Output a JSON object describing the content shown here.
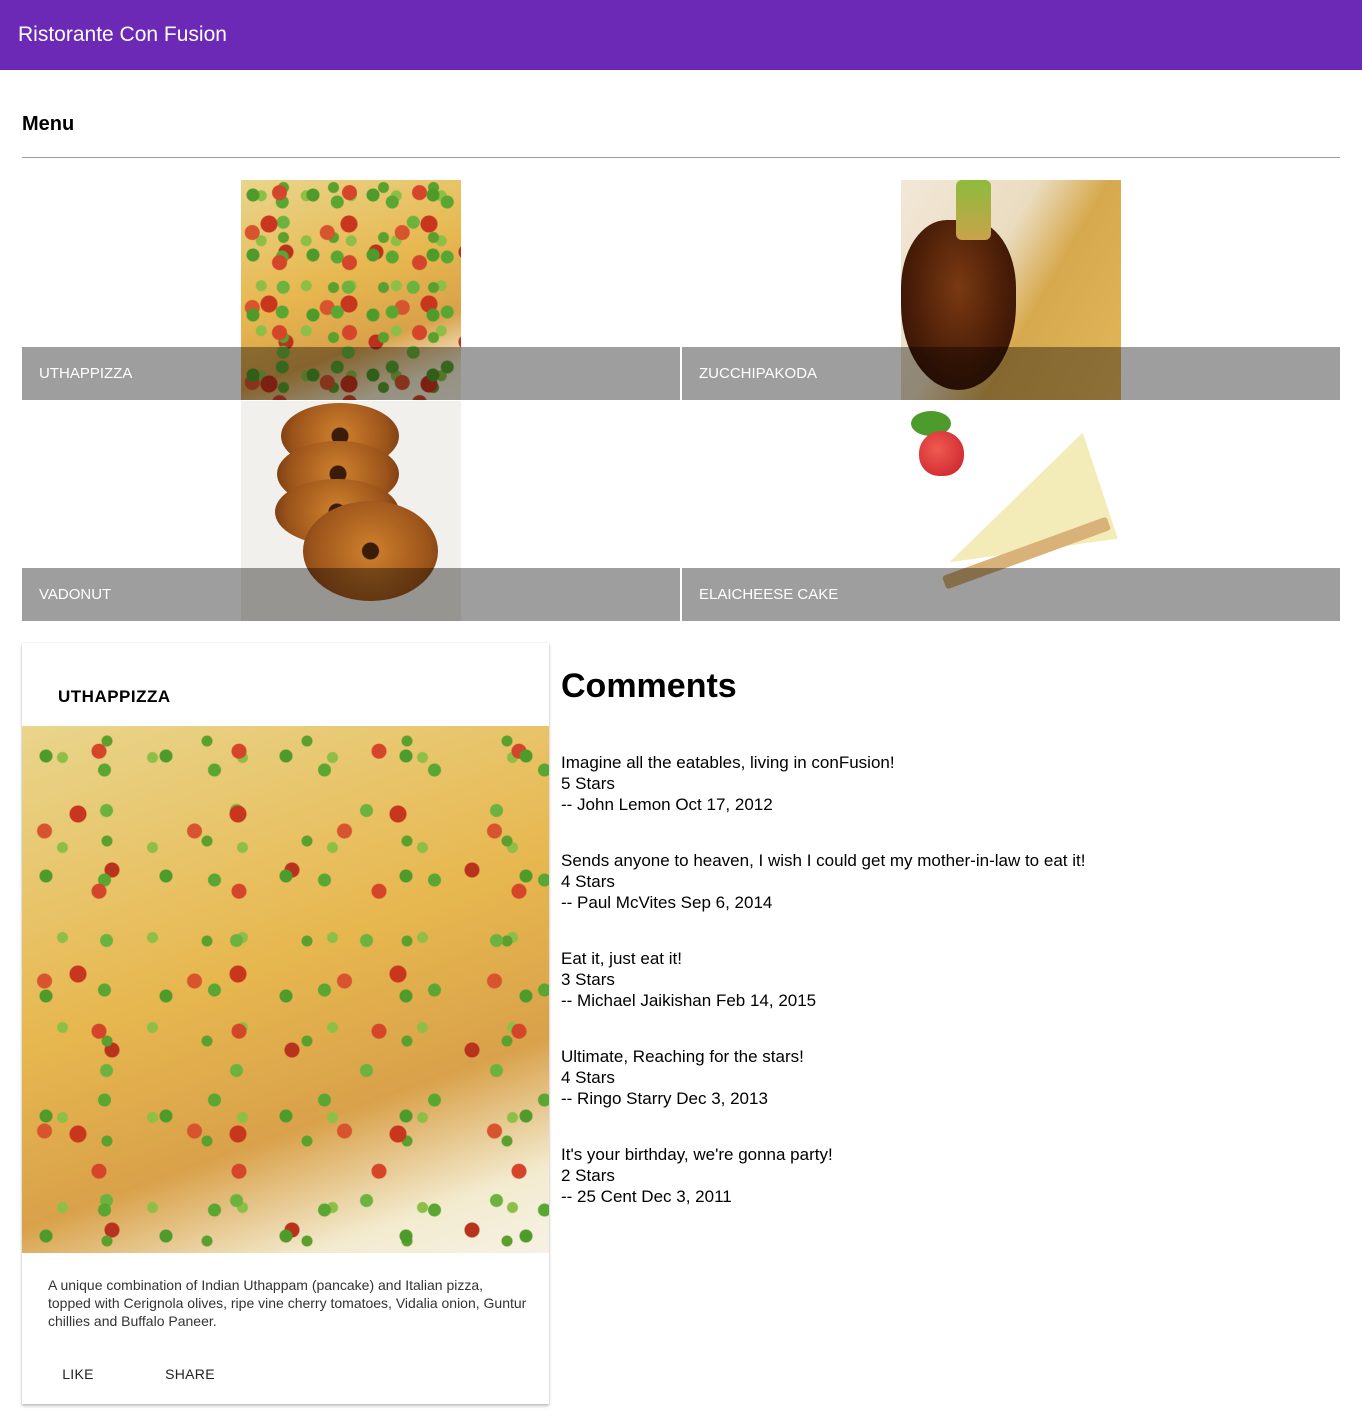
{
  "toolbar": {
    "title": "Ristorante Con Fusion"
  },
  "menu": {
    "heading": "Menu",
    "dishes": [
      {
        "name": "Uthappizza",
        "image_icon": "pizza-image"
      },
      {
        "name": "Zucchipakoda",
        "image_icon": "pakoda-image"
      },
      {
        "name": "Vadonut",
        "image_icon": "donut-image"
      },
      {
        "name": "ElaiCheese Cake",
        "image_icon": "cheesecake-image"
      }
    ]
  },
  "selected_dish": {
    "name": "UTHAPPIZZA",
    "image_icon": "pizza-image",
    "description": "A unique combination of Indian Uthappam (pancake) and Italian pizza, topped with Cerignola olives, ripe vine cherry tomatoes, Vidalia onion, Guntur chillies and Buffalo Paneer.",
    "actions": {
      "like": "LIKE",
      "share": "SHARE"
    }
  },
  "comments": {
    "heading": "Comments",
    "items": [
      {
        "text": "Imagine all the eatables, living in conFusion!",
        "rating": "5 Stars",
        "byline": "-- John Lemon Oct 17, 2012"
      },
      {
        "text": "Sends anyone to heaven, I wish I could get my mother-in-law to eat it!",
        "rating": "4 Stars",
        "byline": "-- Paul McVites Sep 6, 2014"
      },
      {
        "text": "Eat it, just eat it!",
        "rating": "3 Stars",
        "byline": "-- Michael Jaikishan Feb 14, 2015"
      },
      {
        "text": "Ultimate, Reaching for the stars!",
        "rating": "4 Stars",
        "byline": "-- Ringo Starry Dec 3, 2013"
      },
      {
        "text": "It's your birthday, we're gonna party!",
        "rating": "2 Stars",
        "byline": "-- 25 Cent Dec 3, 2011"
      }
    ]
  },
  "colors": {
    "toolbar": "#6c29b6",
    "tile_footer": "rgba(0,0,0,0.38)"
  }
}
